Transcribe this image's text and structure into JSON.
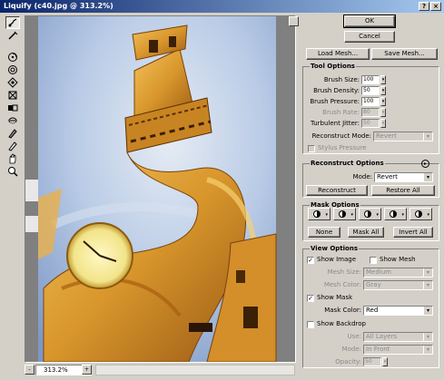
{
  "window": {
    "title": "Liquify (c40.jpg @ 313.2%)",
    "close_glyph": "×",
    "help_glyph": "?"
  },
  "toolbox": {
    "tools": [
      "warp-tool-icon",
      "reconstruct-tool-icon",
      "twirl-cw-icon",
      "twirl-ccw-icon",
      "pucker-icon",
      "bloat-icon",
      "shift-pixels-icon",
      "reflection-icon",
      "turbulence-icon",
      "freeze-mask-icon",
      "thaw-mask-icon",
      "hand-icon",
      "zoom-icon"
    ]
  },
  "status": {
    "zoom_value": "313.2%",
    "minus_glyph": "-",
    "plus_glyph": "+"
  },
  "buttons": {
    "ok": "OK",
    "cancel": "Cancel",
    "load_mesh": "Load Mesh...",
    "save_mesh": "Save Mesh..."
  },
  "tool_options": {
    "title": "Tool Options",
    "brush_size_label": "Brush Size:",
    "brush_size": "100",
    "brush_density_label": "Brush Density:",
    "brush_density": "50",
    "brush_pressure_label": "Brush Pressure:",
    "brush_pressure": "100",
    "brush_rate_label": "Brush Rate:",
    "brush_rate": "80",
    "turbulent_jitter_label": "Turbulent Jitter:",
    "turbulent_jitter": "50",
    "reconstruct_mode_label": "Reconstruct Mode:",
    "reconstruct_mode": "Revert",
    "stylus_pressure_label": "Stylus Pressure"
  },
  "reconstruct_options": {
    "title": "Reconstruct Options",
    "mode_label": "Mode:",
    "mode": "Revert",
    "reconstruct": "Reconstruct",
    "restore_all": "Restore All"
  },
  "mask_options": {
    "title": "Mask Options",
    "none": "None",
    "mask_all": "Mask All",
    "invert_all": "Invert All"
  },
  "view_options": {
    "title": "View Options",
    "show_image": "Show Image",
    "show_mesh": "Show Mesh",
    "mesh_size_label": "Mesh Size:",
    "mesh_size": "Medium",
    "mesh_color_label": "Mesh Color:",
    "mesh_color": "Gray",
    "show_mask": "Show Mask",
    "mask_color_label": "Mask Color:",
    "mask_color": "Red",
    "show_backdrop": "Show Backdrop",
    "use_label": "Use:",
    "use": "All Layers",
    "mode_label": "Mode:",
    "mode": "In Front",
    "opacity_label": "Opacity:",
    "opacity": "50"
  },
  "check_glyph": "✓",
  "arrow_glyph": "▾",
  "colors": {
    "title_start": "#0a246a",
    "title_end": "#a6caf0",
    "panel": "#d4d0c8",
    "sky": "#bcd0ea",
    "stone": "#e0a83a"
  }
}
